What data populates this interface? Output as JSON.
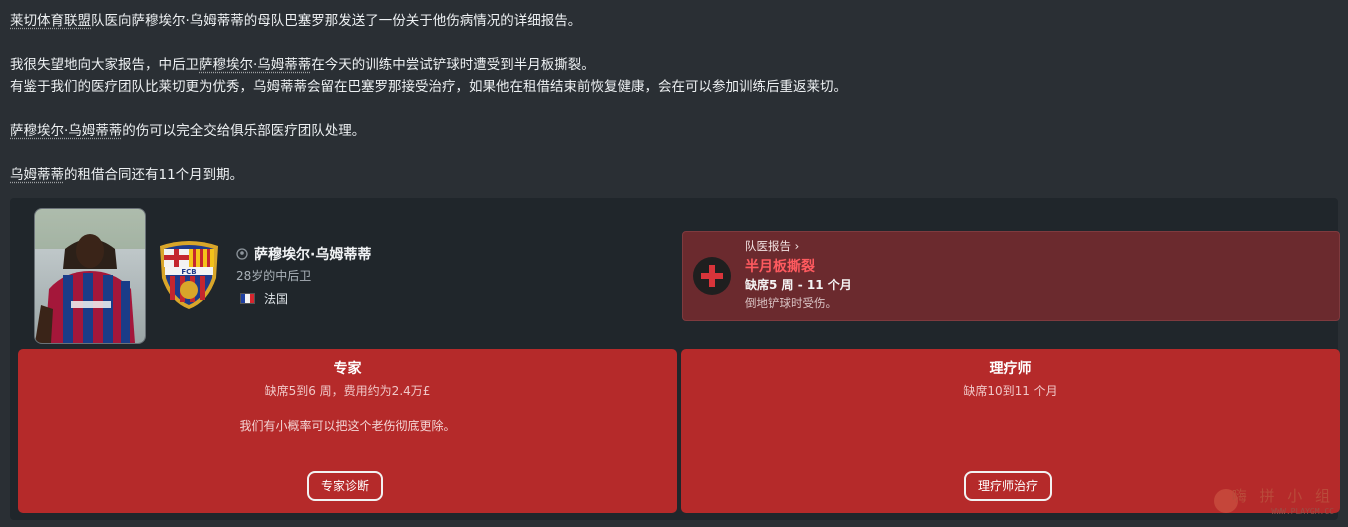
{
  "message": {
    "line1_link": "莱切体育联盟",
    "line1_rest": "队医向萨穆埃尔·乌姆蒂蒂的母队巴塞罗那发送了一份关于他伤病情况的详细报告。",
    "line2_pre": "我很失望地向大家报告，中后卫",
    "line2_link": "萨穆埃尔·乌姆蒂蒂",
    "line2_post": "在今天的训练中尝试铲球时遭受到半月板撕裂。",
    "line3": "有鉴于我们的医疗团队比莱切更为优秀，乌姆蒂蒂会留在巴塞罗那接受治疗，如果他在租借结束前恢复健康，会在可以参加训练后重返莱切。",
    "line4_link": "萨穆埃尔·乌姆蒂蒂",
    "line4_rest": "的伤可以完全交给俱乐部医疗团队处理。",
    "line5_link": "乌姆蒂蒂",
    "line5_rest": "的租借合同还有11个月到期。"
  },
  "player": {
    "name": "萨穆埃尔·乌姆蒂蒂",
    "age_position": "28岁的中后卫",
    "nationality": "法国",
    "crest_text": "FCB"
  },
  "report": {
    "link_label": "队医报告 ›",
    "injury": "半月板撕裂",
    "absence": "缺席5 周 - 11 个月",
    "description": "倒地铲球时受伤。"
  },
  "options": [
    {
      "title": "专家",
      "subtitle": "缺席5到6 周，费用约为2.4万£",
      "note": "我们有小概率可以把这个老伤彻底更除。",
      "button": "专家诊断"
    },
    {
      "title": "理疗师",
      "subtitle": "缺席10到11 个月",
      "note": "",
      "button": "理疗师治疗"
    }
  ],
  "watermark": {
    "title": "嗨 拼 小 组",
    "site": "WWW.PLAYGM.CC"
  },
  "colors": {
    "background": "#2a2f34",
    "panel": "#20262b",
    "card": "#b52a2a",
    "report_bg": "#6b2a2e",
    "injury_text": "#ff5a5f"
  }
}
